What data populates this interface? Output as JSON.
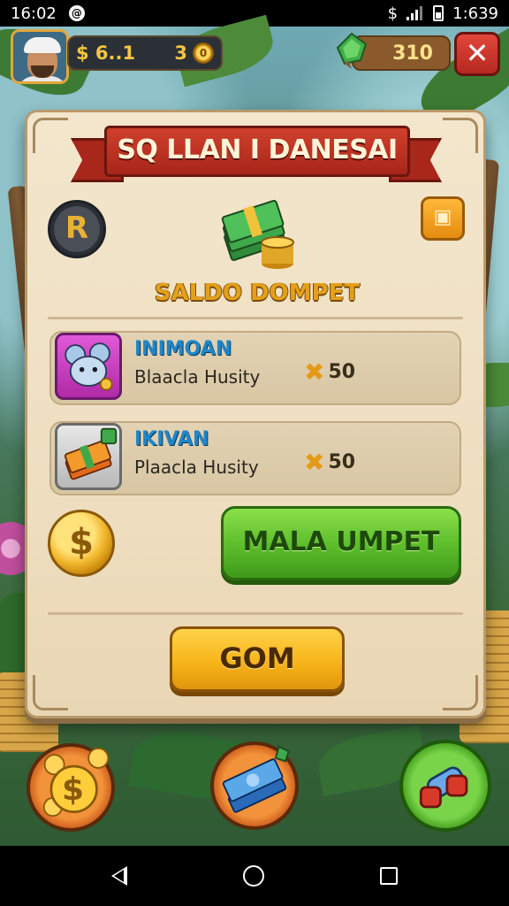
{
  "status_bar": {
    "time": "16:02",
    "dollar": "$",
    "clock": "1:639",
    "app_badge": "@"
  },
  "hud": {
    "money_value": "$ 6..1",
    "coins_count": "3",
    "coin_symbol": "0",
    "gems_count": "310",
    "close_glyph": "✕"
  },
  "dialog": {
    "title": "SQ LLAN I DANESAI",
    "badge_glyph": "R",
    "ticket_glyph": "▣",
    "wallet_label": "SALDO DOMPET",
    "items": [
      {
        "name": "INIMOAN",
        "subtitle": "Blaacla Husity",
        "cost": "50",
        "cost_mark": "✖"
      },
      {
        "name": "IKIVAN",
        "subtitle": "Plaacla Husity",
        "cost": "50",
        "cost_mark": "✖"
      }
    ],
    "dollar_glyph": "$",
    "primary_button": "MALA UMPET",
    "secondary_button": "GOM"
  },
  "bottom_buttons": {
    "coins_glyph": "$",
    "cash_glyph": "$"
  },
  "colors": {
    "accent_green": "#5fbf2c",
    "accent_yellow": "#f7b51a",
    "ribbon_red": "#c0392b",
    "parchment": "#f0e2c6"
  }
}
